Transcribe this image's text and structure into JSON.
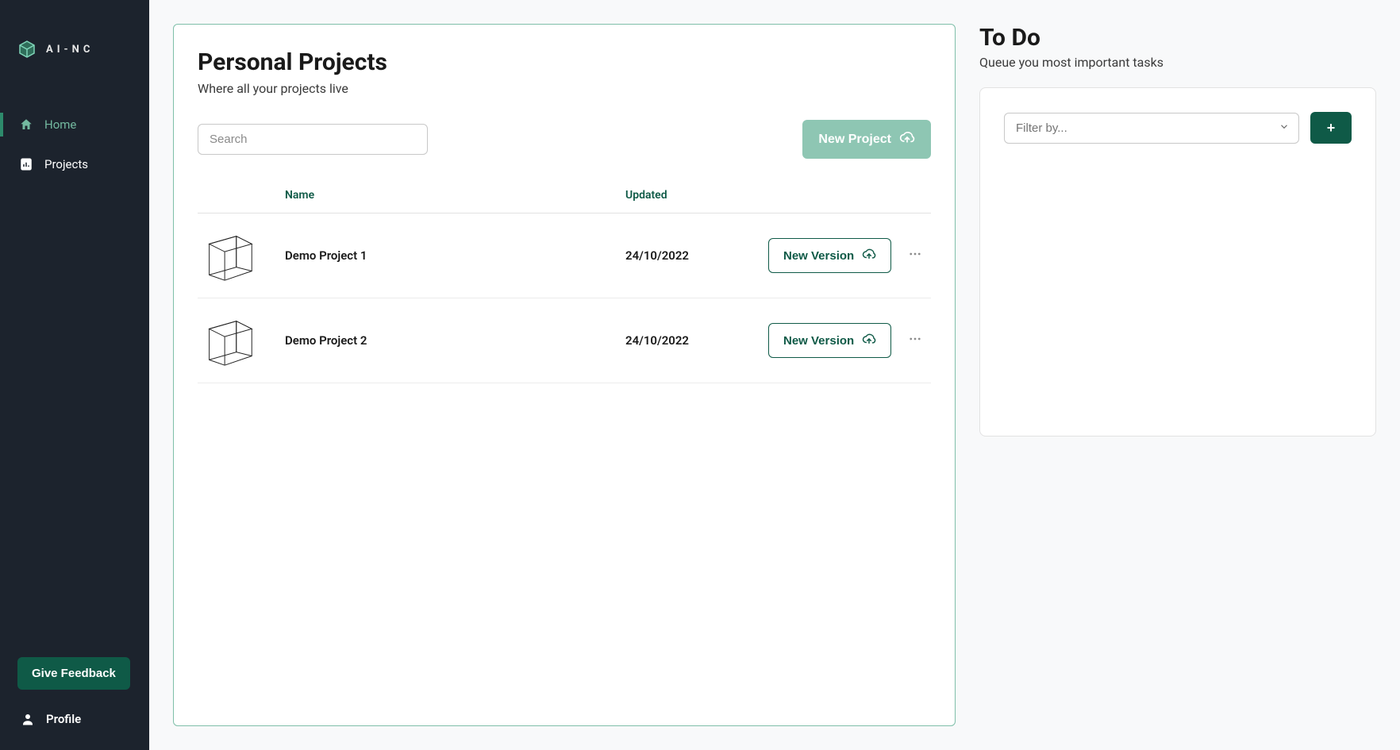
{
  "brand": {
    "name": "AI-NC"
  },
  "sidebar": {
    "nav": [
      {
        "label": "Home",
        "icon": "home",
        "active": true
      },
      {
        "label": "Projects",
        "icon": "projects",
        "active": false
      }
    ],
    "feedback_label": "Give Feedback",
    "profile_label": "Profile"
  },
  "projects": {
    "title": "Personal Projects",
    "subtitle": "Where all your projects live",
    "search_placeholder": "Search",
    "new_project_label": "New Project",
    "new_version_label": "New Version",
    "columns": {
      "name": "Name",
      "updated": "Updated"
    },
    "rows": [
      {
        "name": "Demo Project 1",
        "updated": "24/10/2022"
      },
      {
        "name": "Demo Project 2",
        "updated": "24/10/2022"
      }
    ]
  },
  "todo": {
    "title": "To Do",
    "subtitle": "Queue you most important tasks",
    "filter_placeholder": "Filter by...",
    "add_label": "+"
  }
}
